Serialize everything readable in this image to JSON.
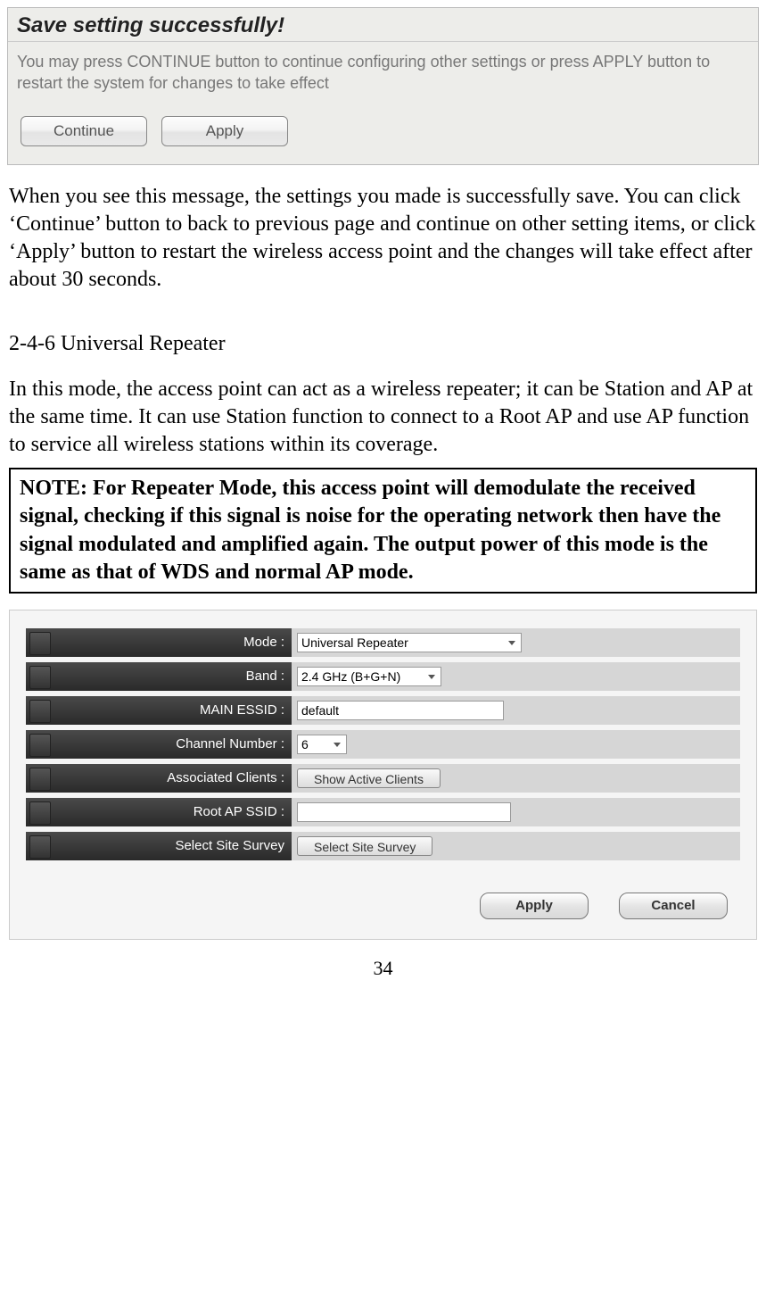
{
  "panel1": {
    "title": "Save setting successfully!",
    "body": "You may press CONTINUE button to continue configuring other settings or press APPLY button to restart the system for changes to take effect",
    "continue_btn": "Continue",
    "apply_btn": "Apply"
  },
  "para1": "When you see this message, the settings you made is successfully save. You can click ‘Continue’ button to back to previous page and continue on other setting items, or click ‘Apply’ button to restart the wireless access point and the changes will take effect after about 30 seconds.",
  "section_head": "2-4-6 Universal Repeater",
  "para2": "In this mode, the access point can act as a wireless repeater; it can be Station and AP at the same time. It can use Station function to connect to a Root AP and use AP function to service all wireless stations within its coverage.",
  "note": "NOTE: For Repeater Mode, this access point will demodulate the received signal, checking if this signal is noise for the operating network then have the signal modulated and amplified again. The output power of this mode is the same as that of WDS and normal AP mode.",
  "form": {
    "mode_label": "Mode :",
    "mode_value": "Universal Repeater",
    "band_label": "Band :",
    "band_value": "2.4 GHz (B+G+N)",
    "essid_label": "MAIN ESSID :",
    "essid_value": "default",
    "channel_label": "Channel Number :",
    "channel_value": "6",
    "clients_label": "Associated Clients :",
    "clients_btn": "Show Active Clients",
    "root_label": "Root AP SSID :",
    "root_value": "",
    "survey_label": "Select Site Survey",
    "survey_btn": "Select Site Survey",
    "apply_btn": "Apply",
    "cancel_btn": "Cancel"
  },
  "page_number": "34"
}
